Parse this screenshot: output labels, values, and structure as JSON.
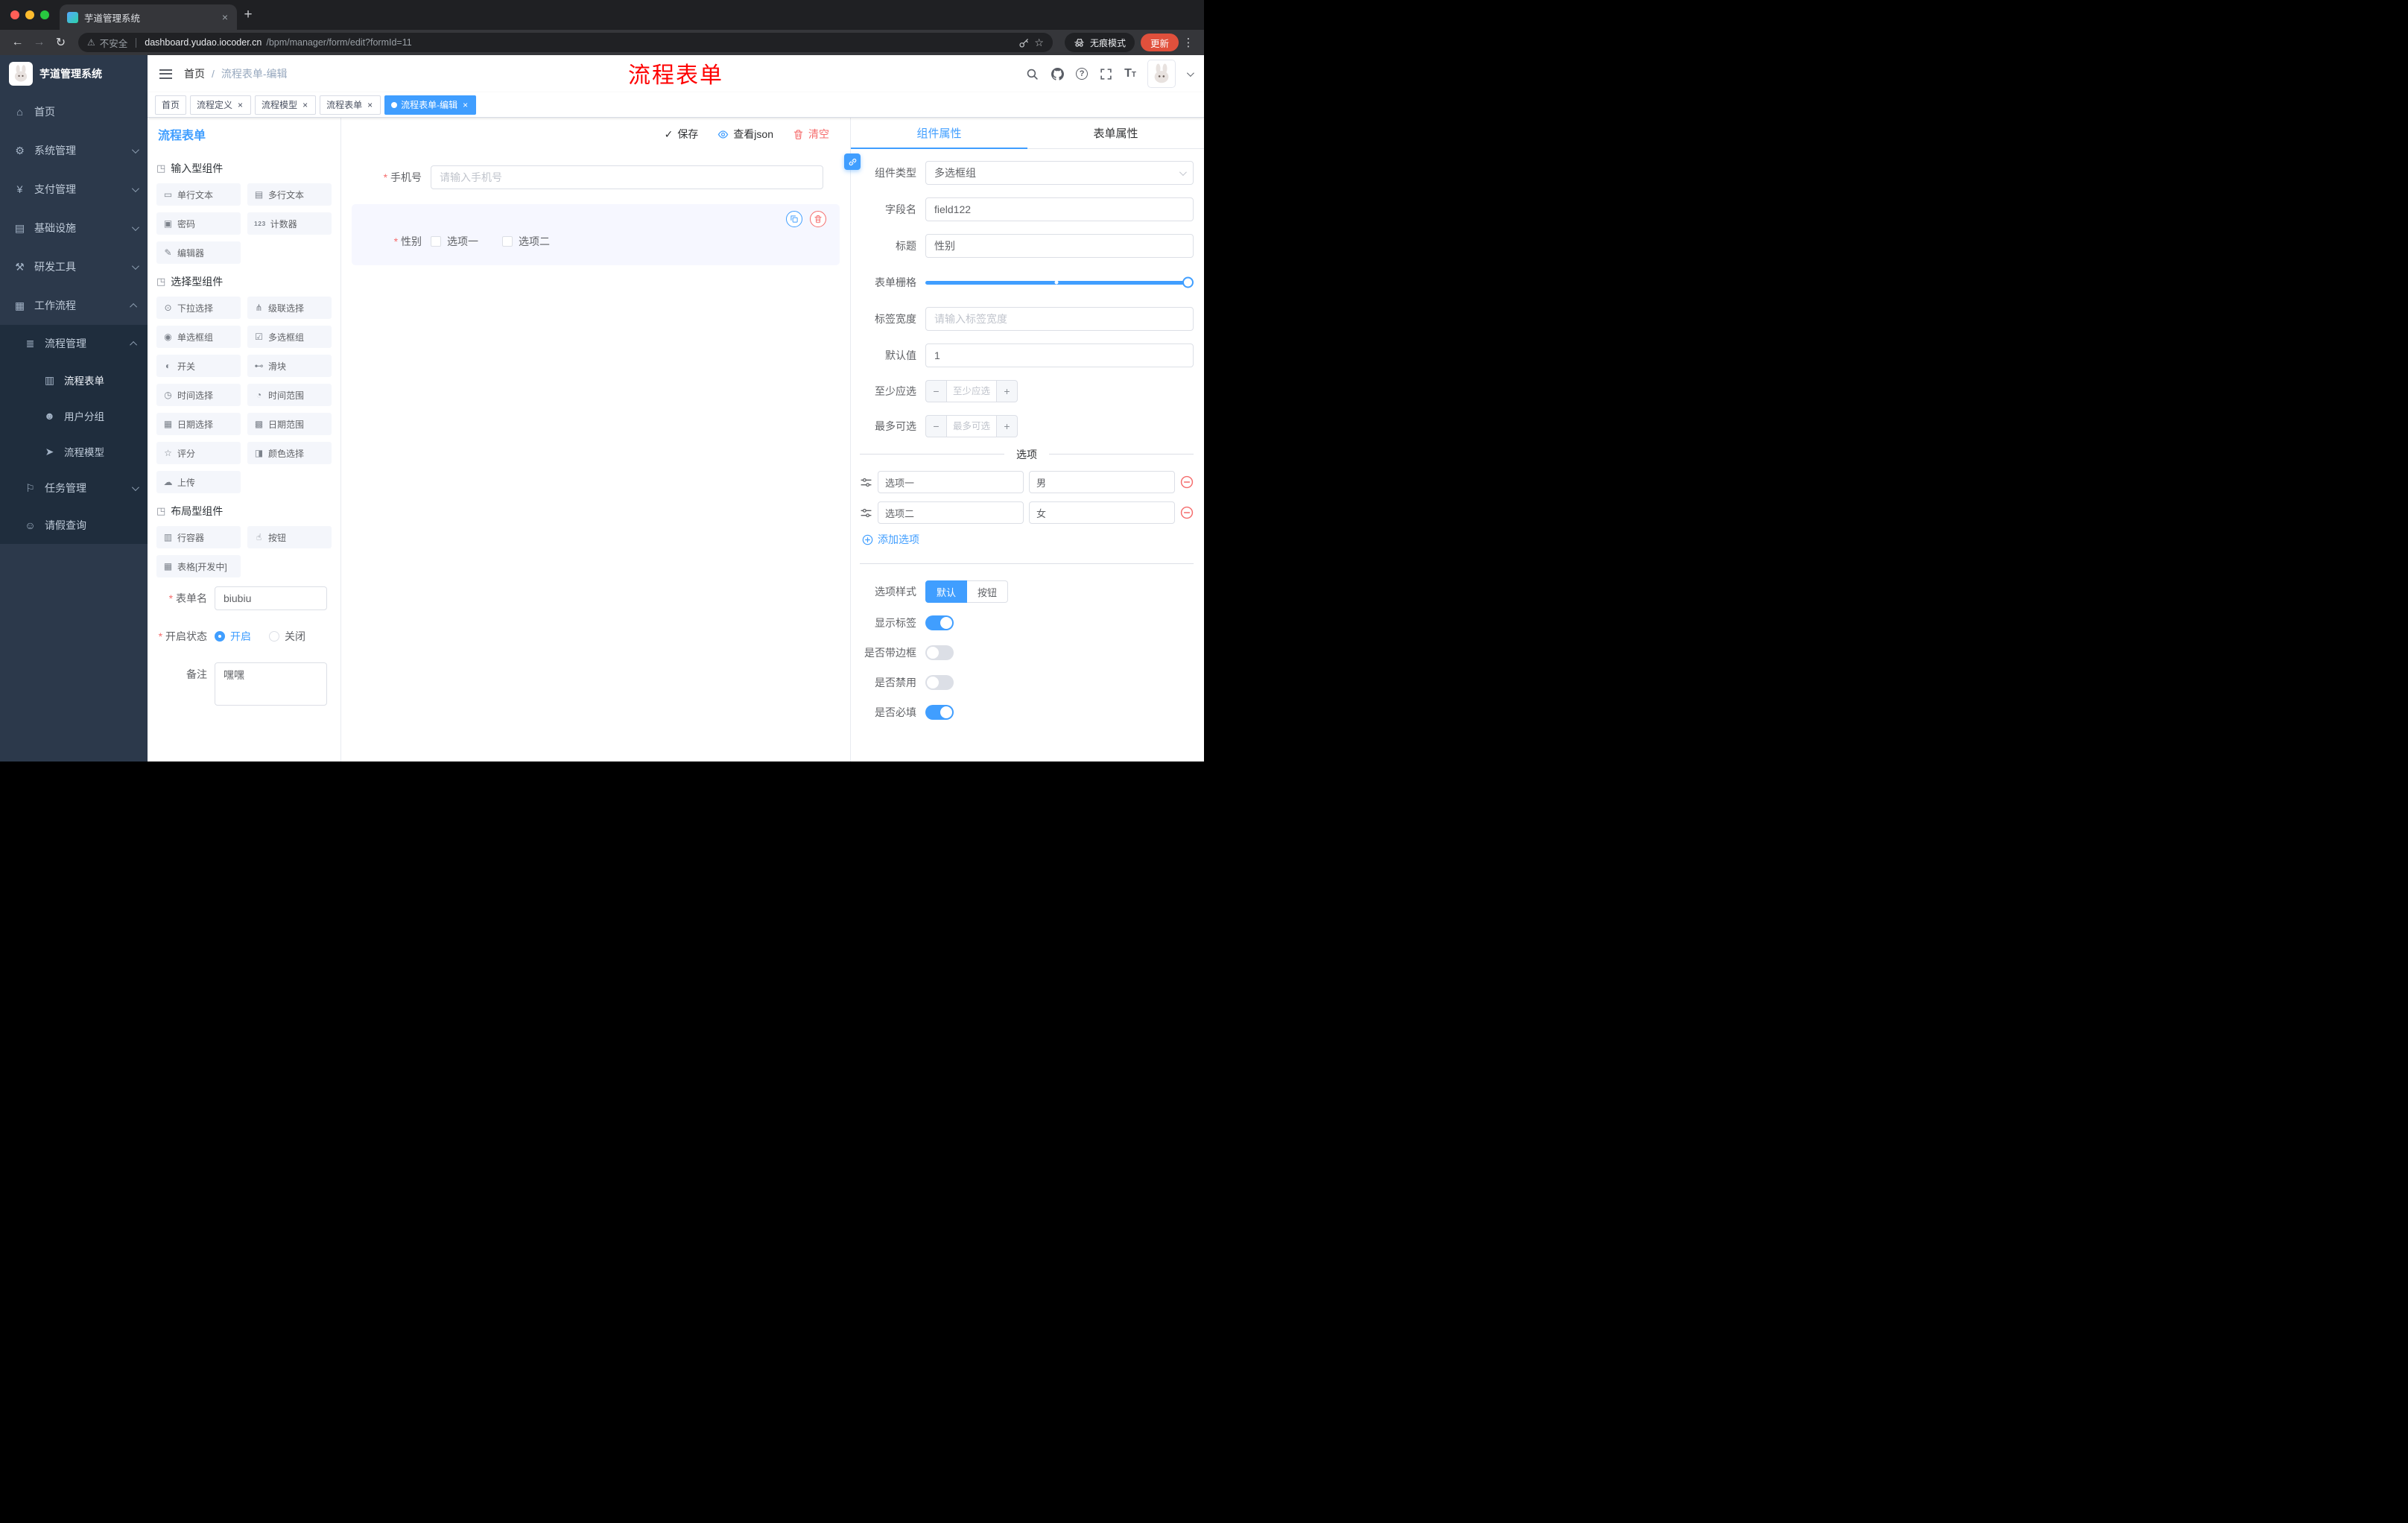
{
  "colors": {
    "accent": "#409eff",
    "danger": "#f56c6c",
    "red_annotation": "#fe0000"
  },
  "glyphs": {
    "close": "×",
    "new_tab": "+",
    "back": "←",
    "forward": "→",
    "reload": "↻",
    "kebab": "⋮",
    "star": "☆",
    "warning": "⚠",
    "check": "✓",
    "question": "?",
    "font_size_big": "T",
    "font_size_small": "T"
  },
  "browser": {
    "tab_title": "芋道管理系统",
    "security_label": "不安全",
    "url_domain": "dashboard.yudao.iocoder.cn",
    "url_path": "/bpm/manager/form/edit?formId=11",
    "incognito_label": "无痕模式",
    "update_label": "更新"
  },
  "sidebar": {
    "logo_title": "芋道管理系统",
    "items": [
      {
        "icon": "⌂",
        "label": "首页"
      },
      {
        "icon": "⚙",
        "label": "系统管理"
      },
      {
        "icon": "¥",
        "label": "支付管理"
      },
      {
        "icon": "▤",
        "label": "基础设施"
      },
      {
        "icon": "⚒",
        "label": "研发工具"
      },
      {
        "icon": "▦",
        "label": "工作流程"
      }
    ],
    "submenu": {
      "manage": {
        "icon": "≣",
        "label": "流程管理"
      },
      "children": [
        {
          "icon": "▥",
          "label": "流程表单"
        },
        {
          "icon": "☻",
          "label": "用户分组"
        },
        {
          "icon": "➤",
          "label": "流程模型"
        }
      ],
      "tasks": {
        "icon": "⚐",
        "label": "任务管理"
      },
      "leave": {
        "icon": "☺",
        "label": "请假查询"
      }
    }
  },
  "header": {
    "breadcrumb_home": "首页",
    "breadcrumb_sep": "/",
    "breadcrumb_current": "流程表单-编辑",
    "overlay_title": "流程表单"
  },
  "tags": [
    {
      "label": "首页"
    },
    {
      "label": "流程定义"
    },
    {
      "label": "流程模型"
    },
    {
      "label": "流程表单"
    },
    {
      "label": "流程表单-编辑"
    }
  ],
  "editor": {
    "panel_title": "流程表单",
    "actions": {
      "save": "保存",
      "view_json": "查看json",
      "clear": "清空"
    },
    "palette": {
      "sections": [
        {
          "icon": "◳",
          "title": "输入型组件",
          "items": [
            {
              "icon": "▭",
              "label": "单行文本"
            },
            {
              "icon": "▤",
              "label": "多行文本"
            },
            {
              "icon": "▣",
              "label": "密码"
            },
            {
              "icon": "123",
              "label": "计数器"
            },
            {
              "icon": "✎",
              "label": "编辑器"
            }
          ]
        },
        {
          "icon": "◳",
          "title": "选择型组件",
          "items": [
            {
              "icon": "⊙",
              "label": "下拉选择"
            },
            {
              "icon": "⋔",
              "label": "级联选择"
            },
            {
              "icon": "◉",
              "label": "单选框组"
            },
            {
              "icon": "☑",
              "label": "多选框组"
            },
            {
              "icon": "◐",
              "label": "开关"
            },
            {
              "icon": "⊷",
              "label": "滑块"
            },
            {
              "icon": "◷",
              "label": "时间选择"
            },
            {
              "icon": "◔",
              "label": "时间范围"
            },
            {
              "icon": "▦",
              "label": "日期选择"
            },
            {
              "icon": "▩",
              "label": "日期范围"
            },
            {
              "icon": "☆",
              "label": "评分"
            },
            {
              "icon": "◨",
              "label": "颜色选择"
            },
            {
              "icon": "☁",
              "label": "上传"
            }
          ]
        },
        {
          "icon": "◳",
          "title": "布局型组件",
          "items": [
            {
              "icon": "▥",
              "label": "行容器"
            },
            {
              "icon": "☝",
              "label": "按钮"
            },
            {
              "icon": "▦",
              "label": "表格[开发中]"
            }
          ]
        }
      ]
    },
    "meta": {
      "name_label": "表单名",
      "name_value": "biubiu",
      "status_label": "开启状态",
      "status_on": "开启",
      "status_off": "关闭",
      "remark_label": "备注",
      "remark_value": "嘿嘿"
    },
    "canvas": {
      "phone_label": "手机号",
      "phone_placeholder": "请输入手机号",
      "gender_label": "性别",
      "gender_options": [
        {
          "label": "选项一"
        },
        {
          "label": "选项二"
        }
      ]
    }
  },
  "inspector": {
    "tab_component": "组件属性",
    "tab_form": "表单属性",
    "rows": {
      "type_label": "组件类型",
      "type_value": "多选框组",
      "field_label": "字段名",
      "field_value": "field122",
      "title_label": "标题",
      "title_value": "性别",
      "grid_label": "表单栅格",
      "width_label": "标签宽度",
      "width_placeholder": "请输入标签宽度",
      "default_label": "默认值",
      "default_value": "1",
      "min_label": "至少应选",
      "min_placeholder": "至少应选",
      "max_label": "最多可选",
      "max_placeholder": "最多可选"
    },
    "stepper": {
      "minus": "−",
      "plus": "+"
    },
    "options": {
      "divider_title": "选项",
      "rows": [
        {
          "name": "选项一",
          "value": "男"
        },
        {
          "name": "选项二",
          "value": "女"
        }
      ],
      "add_label": "添加选项"
    },
    "style": {
      "label": "选项样式",
      "default_option": "默认",
      "button_option": "按钮"
    },
    "toggles": [
      {
        "label": "显示标签",
        "on": true
      },
      {
        "label": "是否带边框",
        "on": false
      },
      {
        "label": "是否禁用",
        "on": false
      },
      {
        "label": "是否必填",
        "on": true
      }
    ]
  }
}
